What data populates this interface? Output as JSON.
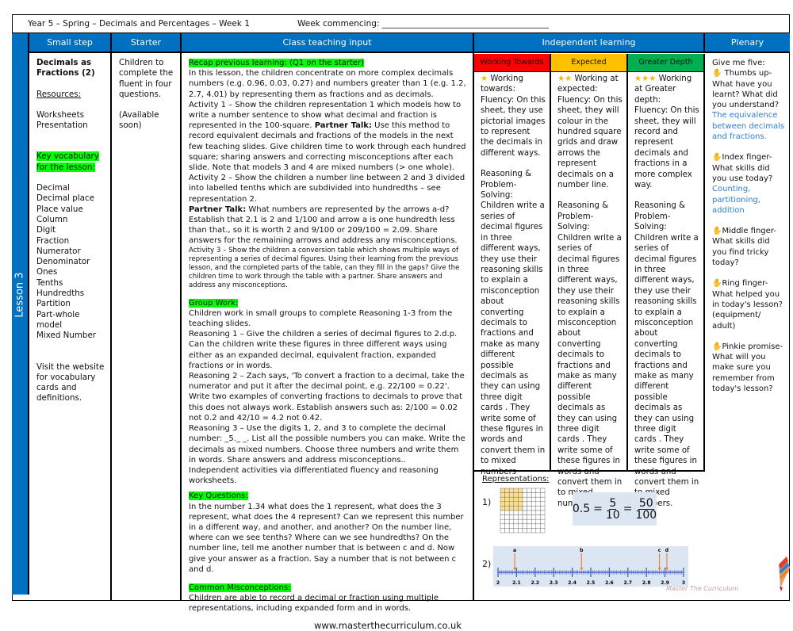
{
  "header": {
    "title": "Year 5 – Spring – Decimals and Percentages – Week 1",
    "week_label": "Week commencing: ________________________________________"
  },
  "columns": {
    "small_step": "Small step",
    "starter": "Starter",
    "class_teaching": "Class teaching input",
    "independent": "Independent learning",
    "plenary": "Plenary"
  },
  "lesson": "Lesson 3",
  "small_step": {
    "title": "Decimals as Fractions (2)",
    "resources_label": "Resources:",
    "resources": [
      "Worksheets",
      "Presentation"
    ],
    "vocab_label": "Key vocabulary for the lesson:",
    "vocab": [
      "Decimal",
      "Decimal place",
      "Place value",
      "Column",
      "Digit",
      "Fraction",
      "Numerator",
      "Denominator",
      "Ones",
      "Tenths",
      "Hundredths",
      "Partition",
      "Part-whole model",
      "Mixed Number"
    ],
    "visit": "Visit the website for vocabulary cards and definitions."
  },
  "starter": {
    "text": "Children to complete the fluent in four questions.",
    "note": "(Available soon)"
  },
  "teaching": {
    "recap_label": "Recap previous learning: (Q1 on the starter)",
    "intro": "In this lesson, the children concentrate on more complex decimals numbers (e.g. 0.96, 0.03, 0.27) and numbers greater than 1 (e.g. 1.2, 2.7, 4.01) by representing them as fractions and as decimals.",
    "activity1a": "Activity 1 – Show the children representation 1 which models how to write a number sentence to show what decimal and fraction is represented in the 100-square. ",
    "partner_talk": "Partner Talk:",
    "activity1b": " Use this method to record equivalent decimals and fractions of the models in the next few teaching slides. Give children time to work through each hundred square; sharing answers and correcting misconceptions after each slide. Note that models 3 and 4 are mixed numbers (> one whole).",
    "activity2a": "Activity 2 – Show the children a number line between 2 and 3 divided into labelled tenths which are subdivided into hundredths – see representation 2.",
    "activity2b": " What numbers are represented by the arrows a-d? Establish that 2.1 is 2 and 1/100 and arrow a is one hundredth less than that., so it is worth 2 and 9/100 or 209/100 = 2.09. Share answers for the remaining arrows and address any misconceptions.",
    "activity3": "Activity 3 – Show the children a conversion table which shows multiple ways of representing a series of decimal figures. Using their learning from the previous lesson, and the completed parts of the table, can they fill in the gaps? Give the children time to work through the table with a partner. Share answers and address any misconceptions.",
    "group_label": "Group Work:",
    "group": "Children work in small groups to complete Reasoning 1-3 from the teaching slides.",
    "r1": "Reasoning 1 – Give the children a series of decimal figures to 2.d.p. Can the children write these figures in three different ways using either as an expanded  decimal, equivalent fraction, expanded fractions or in words.",
    "r2": "Reasoning 2 – Zach says, 'To convert a fraction to a decimal, take the numerator and put it after the decimal point, e.g. 22/100 = 0.22'. Write two examples of converting fractions to decimals to prove that this does not always work. Establish answers such as: 2/100 = 0.02 not 0.2 and 42/10 = 4.2 not 0.42.",
    "r3": "Reasoning 3 – Use the digits 1, 2, and 3 to complete the decimal number: _5._ _. List all the possible numbers you can make. Write the decimals as mixed numbers. Choose three numbers and write them in words. Share answers and address misconceptions..",
    "independent": "Independent activities via differentiated fluency and reasoning worksheets.",
    "kq_label": "Key Questions:",
    "kq": "In the number 1.34 what does the 1 represent, what does the 3 represent, what does the 4 represent? Can we represent this number in a different way, and another, and another? On the number line, where can we see tenths? Where can we see hundredths? On the number line, tell me another number that is between c and d. Now give your answer as a fraction. Say a number that is not between c and d.",
    "cm_label": "Common Misconceptions:",
    "cm": "Children are able to record a decimal or fraction using multiple representations, including expanded form and in words.",
    "website": "www.masterthecurriculum.co.uk"
  },
  "independent": {
    "levels": [
      {
        "label": "Working Towards",
        "color": "#ff0000",
        "stars": "★",
        "intro": "Working towards:",
        "fluency": "Fluency: On this sheet, they use pictorial images to represent the decimals in different ways.",
        "reasoning": "Reasoning & Problem-Solving: Children write a series of decimal figures in three different ways, they use their reasoning skills to explain a misconception about converting decimals to fractions and make as many different possible decimals as they can using three digit cards . They write some of these figures in words and convert them in to mixed numbers"
      },
      {
        "label": "Expected",
        "color": "#ffc000",
        "stars": "★★",
        "intro": "Working at expected:",
        "fluency": "Fluency: On this sheet, they will colour in the hundred square grids and draw arrows the represent decimals on a number line.",
        "reasoning": "Reasoning & Problem-Solving: Children write a series of decimal figures in three different ways, they use their reasoning skills to explain a misconception about converting decimals to fractions and make as many different possible decimals as they can using three digit cards . They write some of these figures in words and convert them in to mixed numbers"
      },
      {
        "label": "Greater Depth",
        "color": "#00b050",
        "stars": "★★★",
        "intro": "Working at Greater depth:",
        "fluency": "Fluency: On this sheet, they will record and represent decimals and fractions in a more complex way.",
        "reasoning": "Reasoning & Problem-Solving: Children write a series of decimal figures in three different ways, they use their reasoning skills to explain a misconception about converting decimals to fractions and make as many different possible decimals as they can using three digit cards . They write some of these figures in words and convert them in to mixed numbers."
      }
    ],
    "representations": {
      "label": "Representations:",
      "r1": "1)",
      "r2": "2)",
      "decimal": "0.5",
      "f1n": "5",
      "f1d": "10",
      "f2n": "50",
      "f2d": "100",
      "shaded_fraction": 0.5,
      "ticks": [
        "2",
        "2.1",
        "2.2",
        "2.3",
        "2.4",
        "2.5",
        "2.6",
        "2.7",
        "2.8",
        "2.9",
        "3"
      ],
      "arrows": [
        {
          "label": "a",
          "value": 2.09
        },
        {
          "label": "b",
          "value": 2.45
        },
        {
          "label": "c",
          "value": 2.87
        },
        {
          "label": "d",
          "value": 2.91
        }
      ]
    }
  },
  "plenary": {
    "intro": "Give me five:",
    "thumb": "Thumbs up- What have you learnt? What did you understand?",
    "thumb_ans": "The equivalence between decimals and fractions.",
    "index": "Index finger- What skills did you use today?",
    "index_ans": "Counting, partitioning, addition",
    "middle": "Middle finger- What skills did you find tricky today?",
    "ring": "Ring finger- What helped you in today's lesson? (equipment/ adult)",
    "pinkie": "Pinkie promise- What will you make sure you remember from today's lesson?",
    "hand_icon": "✋"
  },
  "logo": "Master The Curriculum"
}
